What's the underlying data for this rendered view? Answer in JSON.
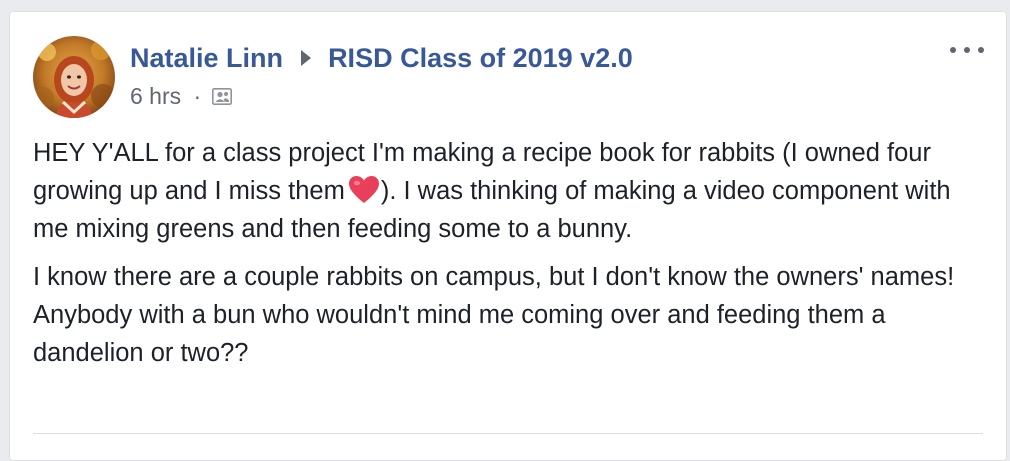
{
  "post": {
    "author": "Natalie Linn",
    "group": "RISD Class of 2019 v2.0",
    "timestamp": "6 hrs",
    "separator": "·",
    "audience_icon": "members-icon",
    "more_icon": "more-options-icon",
    "paragraphs": [
      {
        "before_heart": "HEY Y'ALL for a class project I'm making a recipe book for rabbits (I owned four growing up and I miss them",
        "after_heart": "). I was thinking of making a video component with me mixing greens and then feeding some to a bunny."
      },
      {
        "text": "I know there are a couple rabbits on campus, but I don't know the owners' names! Anybody with a bun who wouldn't mind me coming over and feeding them a dandelion or two??"
      }
    ],
    "emoji": "heart-emoji"
  },
  "colors": {
    "link": "#385898",
    "meta": "#616770",
    "text": "#1d2129",
    "heart": "#e8405a"
  }
}
